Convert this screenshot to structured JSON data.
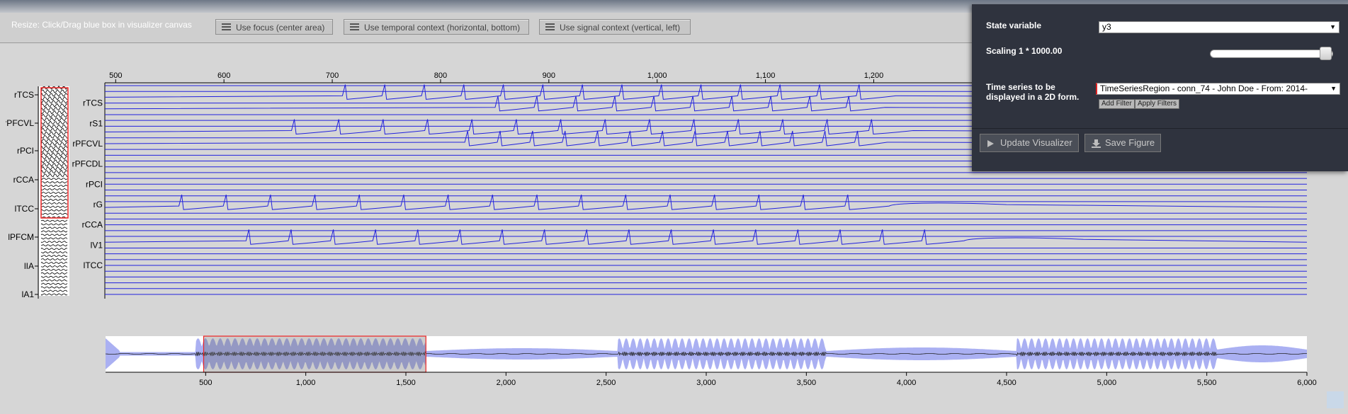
{
  "toolbar": {
    "resize_hint": "Resize: Click/Drag blue box in visualizer canvas",
    "focus_button": "Use focus (center area)",
    "temporal_button": "Use temporal context (horizontal, bottom)",
    "signal_button": "Use signal context (vertical, left)"
  },
  "panel": {
    "state_variable_label": "State variable",
    "state_variable_value": "y3",
    "scaling_label": "Scaling 1 * 1000.00",
    "scaling_fraction": 0.98,
    "timeseries_label_line1": "Time series to be",
    "timeseries_label_line2": "displayed in a 2D form.",
    "timeseries_value": "TimeSeriesRegion - conn_74 - John Doe - From: 2014-",
    "add_filter": "Add Filter",
    "apply_filters": "Apply Filters",
    "update_button": "Update Visualizer",
    "save_button": "Save Figure"
  },
  "signal_context": {
    "labels": [
      "rTCS",
      "rPFCVL",
      "rPCI",
      "rCCA",
      "lTCC",
      "lPFCM",
      "lIA",
      "lA1"
    ]
  },
  "main_view": {
    "x_ticks": [
      "500",
      "600",
      "700",
      "800",
      "900",
      "1,000",
      "1,100",
      "1,200"
    ],
    "x_tick_values": [
      500,
      600,
      700,
      800,
      900,
      1000,
      1100,
      1200
    ],
    "x_range": [
      490,
      1600
    ],
    "channel_labels": [
      "rTCS",
      "rS1",
      "rPFCVL",
      "rPFCDL",
      "rPCI",
      "rG",
      "rCCA",
      "lV1",
      "lTCC"
    ],
    "spike_rows": [
      {
        "row": 2,
        "start": 712,
        "interval": 36.5,
        "end": 1210,
        "decay": false
      },
      {
        "row": 4,
        "start": 853,
        "interval": 36,
        "end": 1210,
        "decay": false
      },
      {
        "row": 8,
        "start": 665,
        "interval": 41,
        "end": 1210,
        "decay": false
      },
      {
        "row": 10,
        "start": 825,
        "interval": 30,
        "end": 1210,
        "decay": false
      },
      {
        "row": 21,
        "start": 561,
        "interval": 41,
        "end": 1212,
        "decay": true
      },
      {
        "row": 27,
        "start": 623,
        "interval": 39,
        "end": 1270,
        "decay": true
      }
    ]
  },
  "temporal_context": {
    "x_ticks": [
      "500",
      "1,000",
      "1,500",
      "2,000",
      "2,500",
      "3,000",
      "3,500",
      "4,000",
      "4,500",
      "5,000",
      "5,500",
      "6,000"
    ],
    "x_tick_values": [
      500,
      1000,
      1500,
      2000,
      2500,
      3000,
      3500,
      4000,
      4500,
      5000,
      5500,
      6000
    ],
    "x_range": [
      0,
      6000
    ],
    "selection": [
      490,
      1600
    ]
  },
  "colors": {
    "signal_line": "#2222dd",
    "envelope": "#aab0f2",
    "selection_border": "#ee2222",
    "panel_bg": "#2f333e"
  }
}
